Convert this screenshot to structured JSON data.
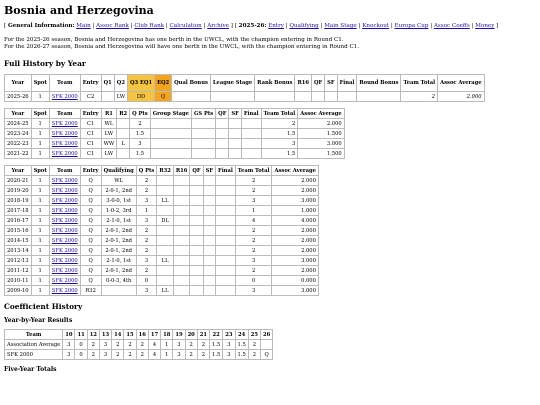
{
  "title": "Bosnia and Herzegovina",
  "nav": {
    "general_label": "General Information:",
    "general_links": [
      "Main",
      "Assoc Rank",
      "Club Rank",
      "Calculation",
      "Archive"
    ],
    "season_label": "2025-26:",
    "season_links": [
      "Entry",
      "Qualifying",
      "Main Stage",
      "Knockout",
      "Europa Cup",
      "Assoc Coeffs",
      "Money"
    ]
  },
  "intro": [
    "For the 2025-26 season, Bosnia and Herzegovina has one berth in the UWCL, with the champion entering in Round C1.",
    "For the 2026-27 season, Bosnia and Herzegovina will have one berth in the UWCL, with the champion entering in Round C1."
  ],
  "history_heading": "Full History by Year",
  "table_a": {
    "headers": [
      "Year",
      "Spot",
      "Team",
      "Entry",
      "Q1",
      "Q2",
      "Q3 EQ1",
      "EQ2",
      "Qual Bonus",
      "League Stage",
      "Rank Bonus",
      "R16",
      "QF",
      "SF",
      "Final",
      "Round Bonus",
      "Team Total",
      "Assoc Average"
    ],
    "rows": [
      [
        "2025-26",
        "1",
        "SFK 2000",
        "C2",
        "",
        "LW",
        "DD",
        "Q",
        "",
        "",
        "",
        "",
        "",
        "",
        "",
        "",
        "2",
        "2.000"
      ]
    ]
  },
  "table_b": {
    "headers": [
      "Year",
      "Spot",
      "Team",
      "Entry",
      "R1",
      "R2",
      "Q Pts",
      "Group Stage",
      "GS Pts",
      "QF",
      "SF",
      "Final",
      "Team Total",
      "Assoc Average"
    ],
    "rows": [
      [
        "2024-25",
        "1",
        "SFK 2000",
        "C1",
        "WL",
        "",
        "2",
        "",
        "",
        "",
        "",
        "",
        "2",
        "2.000"
      ],
      [
        "2023-24",
        "1",
        "SFK 2000",
        "C1",
        "LW",
        "",
        "1.5",
        "",
        "",
        "",
        "",
        "",
        "1.5",
        "1.500"
      ],
      [
        "2022-23",
        "1",
        "SFK 2000",
        "C1",
        "WW",
        "L",
        "3",
        "",
        "",
        "",
        "",
        "",
        "3",
        "3.000"
      ],
      [
        "2021-22",
        "1",
        "SFK 2000",
        "C1",
        "LW",
        "",
        "1.5",
        "",
        "",
        "",
        "",
        "",
        "1.5",
        "1.500"
      ]
    ]
  },
  "table_c": {
    "headers": [
      "Year",
      "Spot",
      "Team",
      "Entry",
      "Qualifying",
      "Q Pts",
      "R32",
      "R16",
      "QF",
      "SF",
      "Final",
      "Team Total",
      "Assoc Average"
    ],
    "rows": [
      [
        "2020-21",
        "1",
        "SFK 2000",
        "Q",
        "WL",
        "2",
        "",
        "",
        "",
        "",
        "",
        "2",
        "2.000"
      ],
      [
        "2019-20",
        "1",
        "SFK 2000",
        "Q",
        "2-0-1, 2nd",
        "2",
        "",
        "",
        "",
        "",
        "",
        "2",
        "2.000"
      ],
      [
        "2018-19",
        "1",
        "SFK 2000",
        "Q",
        "3-0-0, 1st",
        "3",
        "LL",
        "",
        "",
        "",
        "",
        "3",
        "3.000"
      ],
      [
        "2017-18",
        "1",
        "SFK 2000",
        "Q",
        "1-0-2, 3rd",
        "1",
        "",
        "",
        "",
        "",
        "",
        "1",
        "1.000"
      ],
      [
        "2016-17",
        "1",
        "SFK 2000",
        "Q",
        "2-1-0, 1st",
        "3",
        "DL",
        "",
        "",
        "",
        "",
        "4",
        "4.000"
      ],
      [
        "2015-16",
        "1",
        "SFK 2000",
        "Q",
        "2-0-1, 2nd",
        "2",
        "",
        "",
        "",
        "",
        "",
        "2",
        "2.000"
      ],
      [
        "2014-15",
        "1",
        "SFK 2000",
        "Q",
        "2-0-1, 2nd",
        "2",
        "",
        "",
        "",
        "",
        "",
        "2",
        "2.000"
      ],
      [
        "2013-14",
        "1",
        "SFK 2000",
        "Q",
        "2-0-1, 2nd",
        "2",
        "",
        "",
        "",
        "",
        "",
        "2",
        "2.000"
      ],
      [
        "2012-13",
        "1",
        "SFK 2000",
        "Q",
        "2-1-0, 1st",
        "3",
        "LL",
        "",
        "",
        "",
        "",
        "3",
        "3.000"
      ],
      [
        "2011-12",
        "1",
        "SFK 2000",
        "Q",
        "2-0-1, 2nd",
        "2",
        "",
        "",
        "",
        "",
        "",
        "2",
        "2.000"
      ],
      [
        "2010-11",
        "1",
        "SFK 2000",
        "Q",
        "0-0-3, 4th",
        "0",
        "",
        "",
        "",
        "",
        "",
        "0",
        "0.000"
      ],
      [
        "2009-10",
        "1",
        "SFK 2000",
        "R32",
        "",
        "3",
        "LL",
        "",
        "",
        "",
        "",
        "3",
        "3.000"
      ]
    ]
  },
  "coef_heading": "Coefficient History",
  "yby_heading": "Year-by-Year Results",
  "table_d": {
    "headers": [
      "Team",
      "10",
      "11",
      "12",
      "13",
      "14",
      "15",
      "16",
      "17",
      "18",
      "19",
      "20",
      "21",
      "22",
      "23",
      "24",
      "25",
      "26"
    ],
    "rows": [
      [
        "Association Average",
        "3",
        "0",
        "2",
        "3",
        "2",
        "2",
        "2",
        "4",
        "1",
        "3",
        "2",
        "2",
        "1.5",
        "3",
        "1.5",
        "2",
        ""
      ],
      [
        "SFK 2000",
        "3",
        "0",
        "2",
        "3",
        "2",
        "2",
        "2",
        "4",
        "1",
        "3",
        "2",
        "2",
        "1.5",
        "3",
        "1.5",
        "2",
        "Q"
      ]
    ]
  },
  "five_year_heading": "Five-Year Totals",
  "colors": {
    "link": "#1a0dab",
    "highlight_orange": "#f4a51c",
    "highlight_yellow": "#f5c542",
    "border": "#bbbbbb"
  }
}
